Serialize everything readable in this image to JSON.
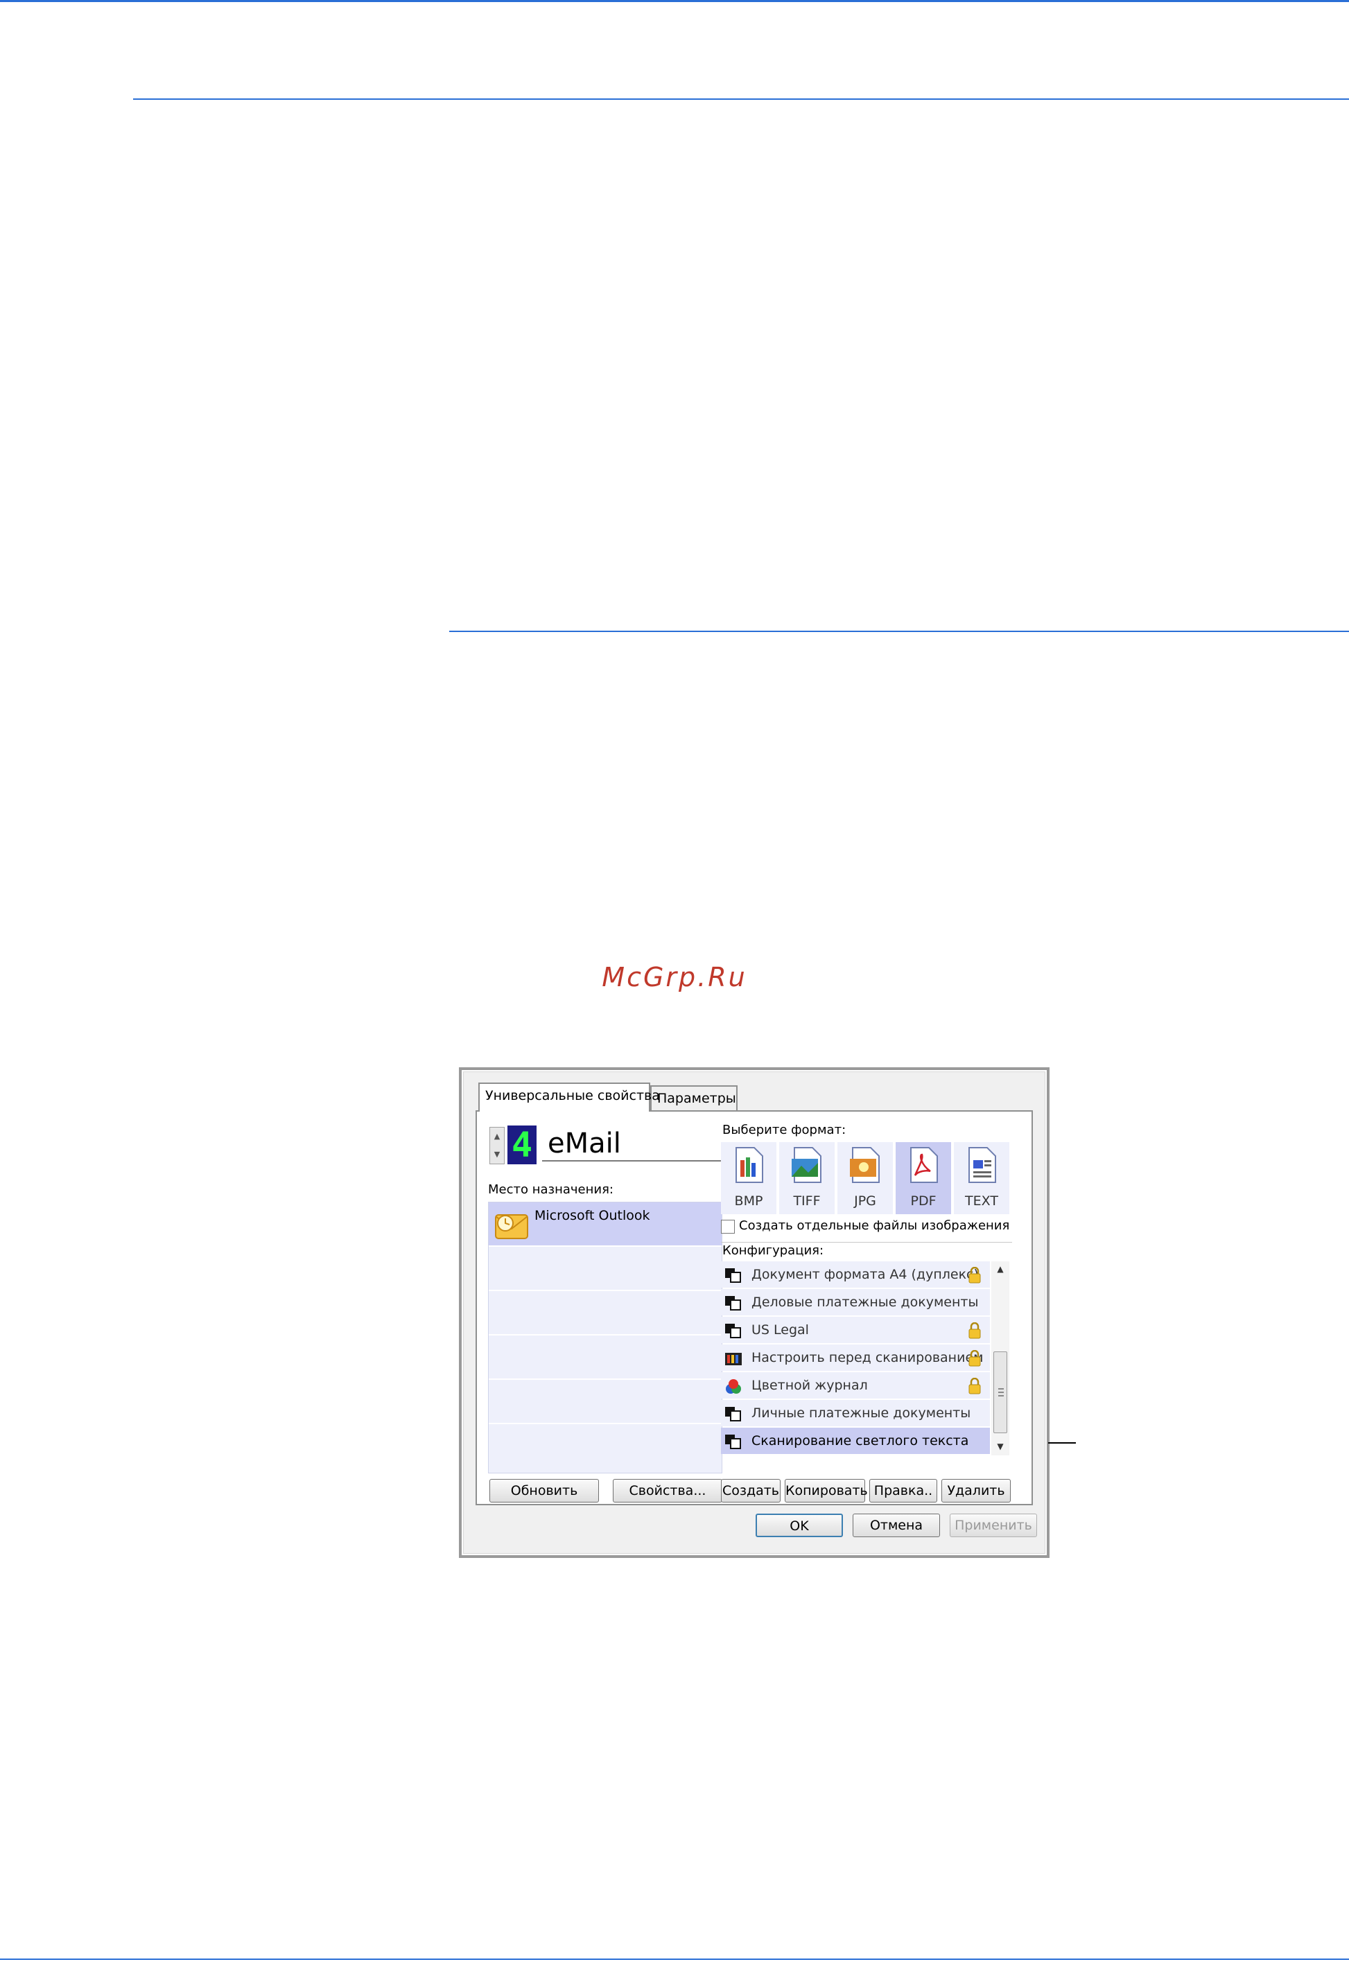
{
  "watermark": "McGrp.Ru",
  "dialog": {
    "tabs": [
      {
        "label": "Универсальные свойства",
        "active": true
      },
      {
        "label": "Параметры",
        "active": false
      }
    ],
    "button_number": "4",
    "button_name": "eMail",
    "destination_label": "Место назначения:",
    "destinations": [
      {
        "label": "Microsoft Outlook",
        "icon": "outlook-icon",
        "selected": true
      },
      {
        "label": ""
      },
      {
        "label": ""
      },
      {
        "label": ""
      },
      {
        "label": ""
      },
      {
        "label": ""
      }
    ],
    "left_buttons": {
      "refresh": "Обновить",
      "properties": "Свойства..."
    },
    "format_label": "Выберите формат:",
    "formats": [
      {
        "label": "BMP",
        "icon": "bmp-file-icon"
      },
      {
        "label": "TIFF",
        "icon": "tiff-file-icon"
      },
      {
        "label": "JPG",
        "icon": "jpg-file-icon"
      },
      {
        "label": "PDF",
        "icon": "pdf-file-icon",
        "selected": true
      },
      {
        "label": "TEXT",
        "icon": "text-file-icon"
      }
    ],
    "separate_files_label": "Создать отдельные файлы изображения",
    "separate_files_checked": false,
    "config_label": "Конфигурация:",
    "configurations": [
      {
        "label": "Документ формата А4 (дуплекс)",
        "locked": true
      },
      {
        "label": "Деловые платежные документы",
        "locked": false
      },
      {
        "label": "US Legal",
        "locked": true
      },
      {
        "label": "Настроить перед сканированием",
        "locked": true
      },
      {
        "label": "Цветной журнал",
        "locked": true
      },
      {
        "label": "Личные платежные документы",
        "locked": false
      },
      {
        "label": "Сканирование светлого текста",
        "locked": false,
        "selected": true
      }
    ],
    "config_buttons": {
      "create": "Создать",
      "copy": "Копировать",
      "edit": "Правка..",
      "delete": "Удалить"
    },
    "footer_buttons": {
      "ok": "OK",
      "cancel": "Отмена",
      "apply": "Применить"
    },
    "colors": {
      "selection": "#c9ccf2",
      "list_bg": "#eef0fb",
      "rule": "#2a6fd6"
    }
  }
}
